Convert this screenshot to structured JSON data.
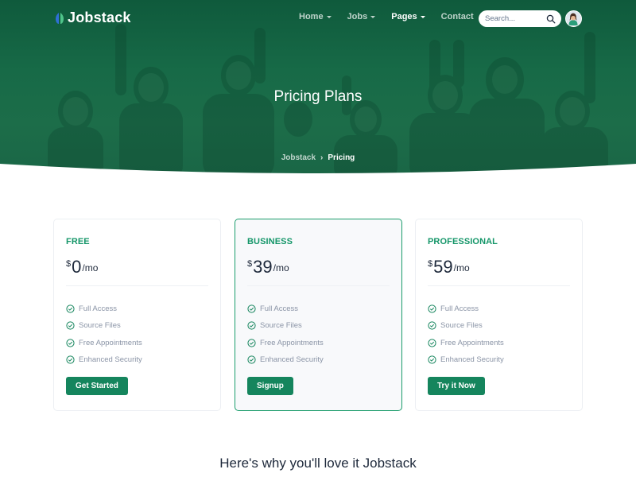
{
  "brand": {
    "name": "Jobstack"
  },
  "nav": {
    "items": [
      {
        "label": "Home",
        "caret": true,
        "active": false
      },
      {
        "label": "Jobs",
        "caret": true,
        "active": false
      },
      {
        "label": "Pages",
        "caret": true,
        "active": true
      },
      {
        "label": "Contact",
        "caret": false,
        "active": false
      }
    ]
  },
  "search": {
    "placeholder": "Search..."
  },
  "hero": {
    "title": "Pricing Plans",
    "breadcrumb": {
      "home": "Jobstack",
      "separator": "›",
      "current": "Pricing"
    }
  },
  "plans": [
    {
      "name": "FREE",
      "currency": "$",
      "amount": "0",
      "period": "/mo",
      "featured": false,
      "button": "Get Started"
    },
    {
      "name": "BUSINESS",
      "currency": "$",
      "amount": "39",
      "period": "/mo",
      "featured": true,
      "button": "Signup"
    },
    {
      "name": "PROFESSIONAL",
      "currency": "$",
      "amount": "59",
      "period": "/mo",
      "featured": false,
      "button": "Try it Now"
    }
  ],
  "features": [
    "Full Access",
    "Source Files",
    "Free Appointments",
    "Enhanced Security"
  ],
  "section": {
    "title": "Here's why you'll love it Jobstack"
  },
  "colors": {
    "primary": "#15855d",
    "hero": "#176a47",
    "accent_text": "#159669"
  },
  "icons": [
    "search-icon",
    "check-circle-icon",
    "chevron-down-icon",
    "logo-icon"
  ]
}
